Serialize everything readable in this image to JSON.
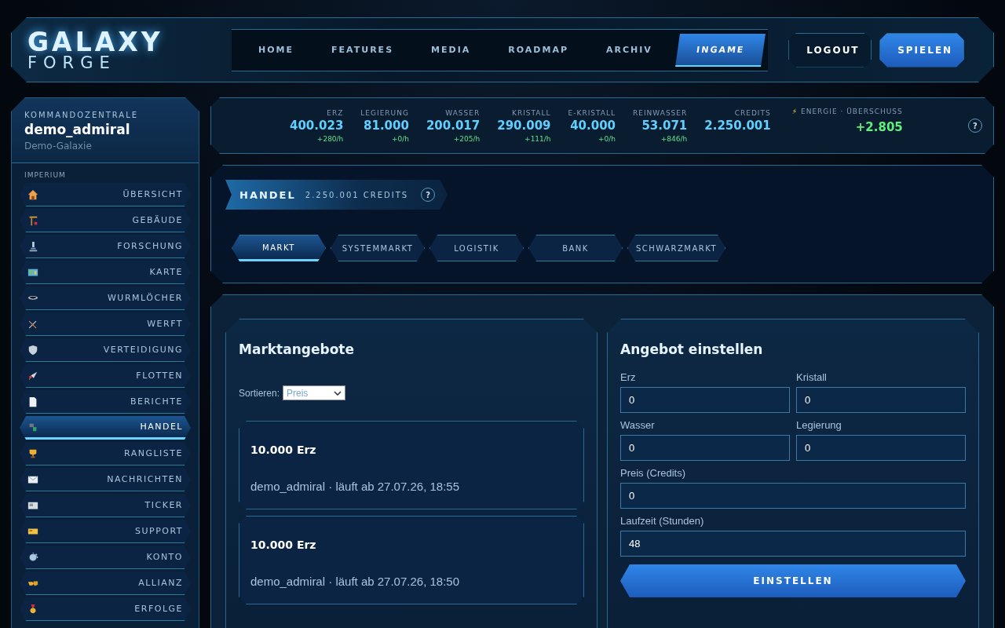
{
  "header": {
    "logo": {
      "line1": "GALAXY",
      "line2": "FORGE"
    },
    "nav": [
      {
        "label": "HOME",
        "selected": false
      },
      {
        "label": "FEATURES",
        "selected": false
      },
      {
        "label": "MEDIA",
        "selected": false
      },
      {
        "label": "ROADMAP",
        "selected": false
      },
      {
        "label": "ARCHIV",
        "selected": false
      },
      {
        "label": "INGAME",
        "selected": true
      }
    ],
    "buttons": [
      {
        "label": "LOGOUT",
        "kind": "ghost"
      },
      {
        "label": "SPIELEN",
        "kind": "primary"
      }
    ]
  },
  "sidebar": {
    "eyebrow": "KOMMANDOZENTRALE",
    "user": "demo_admiral",
    "galaxy": "Demo-Galaxie",
    "section": "IMPERIUM",
    "items": [
      {
        "label": "ÜBERSICHT",
        "selected": false
      },
      {
        "label": "GEBÄUDE",
        "selected": false
      },
      {
        "label": "FORSCHUNG",
        "selected": false
      },
      {
        "label": "KARTE",
        "selected": false
      },
      {
        "label": "WURMLÖCHER",
        "selected": false
      },
      {
        "label": "WERFT",
        "selected": false
      },
      {
        "label": "VERTEIDIGUNG",
        "selected": false
      },
      {
        "label": "FLOTTEN",
        "selected": false
      },
      {
        "label": "BERICHTE",
        "selected": false
      },
      {
        "label": "HANDEL",
        "selected": true
      },
      {
        "label": "RANGLISTE",
        "selected": false
      },
      {
        "label": "NACHRICHTEN",
        "selected": false
      },
      {
        "label": "TICKER",
        "selected": false
      },
      {
        "label": "SUPPORT",
        "selected": false
      },
      {
        "label": "KONTO",
        "selected": false
      },
      {
        "label": "ALLIANZ",
        "selected": false
      },
      {
        "label": "ERFOLGE",
        "selected": false
      }
    ]
  },
  "resources": {
    "items": [
      {
        "label": "ERZ",
        "value": "400.023",
        "rate": "+280/h"
      },
      {
        "label": "LEGIERUNG",
        "value": "81.000",
        "rate": "+0/h"
      },
      {
        "label": "WASSER",
        "value": "200.017",
        "rate": "+205/h"
      },
      {
        "label": "KRISTALL",
        "value": "290.009",
        "rate": "+111/h"
      },
      {
        "label": "E-KRISTALL",
        "value": "40.000",
        "rate": "+0/h"
      },
      {
        "label": "REINWASSER",
        "value": "53.071",
        "rate": "+846/h"
      }
    ],
    "credits": {
      "label": "CREDITS",
      "value": "2.250.001"
    },
    "energy": {
      "symbol": "⚡",
      "label": "ENERGIE · ÜBERSCHUSS",
      "value": "+2.805"
    },
    "help": "?"
  },
  "trade": {
    "title": "HANDEL",
    "credits": "2.250.001 CREDITS",
    "help": "?",
    "tabs": [
      {
        "label": "MARKT",
        "selected": true
      },
      {
        "label": "SYSTEMMARKT",
        "selected": false
      },
      {
        "label": "LOGISTIK",
        "selected": false
      },
      {
        "label": "BANK",
        "selected": false
      },
      {
        "label": "SCHWARZMARKT",
        "selected": false
      }
    ]
  },
  "offers": {
    "title": "Marktangebote",
    "sort_label": "Sortieren:",
    "sort_value": "Preis",
    "items": [
      {
        "amount": "10.000 Erz",
        "meta": "demo_admiral · läuft ab 27.07.26, 18:55"
      },
      {
        "amount": "10.000 Erz",
        "meta": "demo_admiral · läuft ab 27.07.26, 18:50"
      }
    ]
  },
  "form": {
    "title": "Angebot einstellen",
    "fields": [
      {
        "label": "Erz",
        "value": "0",
        "kind": "half"
      },
      {
        "label": "Kristall",
        "value": "0",
        "kind": "half"
      },
      {
        "label": "Wasser",
        "value": "0",
        "kind": "half"
      },
      {
        "label": "Legierung",
        "value": "0",
        "kind": "half"
      },
      {
        "label": "Preis (Credits)",
        "value": "0",
        "kind": "full"
      },
      {
        "label": "Laufzeit (Stunden)",
        "value": "48",
        "kind": "full"
      }
    ],
    "button": "EINSTELLEN"
  }
}
